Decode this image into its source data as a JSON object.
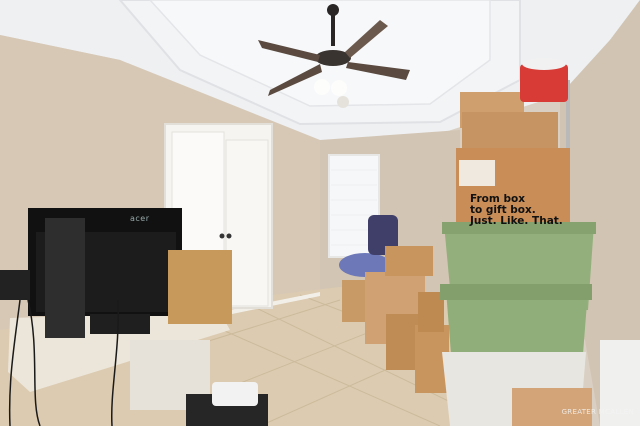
{
  "scene": {
    "box_text": [
      "From box",
      "to gift box.",
      "Just. Like. That."
    ],
    "monitor_brand": "acer",
    "watermark": "GREATER MCALLEN"
  },
  "colors": {
    "wall": "#d8ccbd",
    "ceiling": "#eef0f2",
    "floor": "#dccbb0",
    "bin_green": "#8fae7a",
    "cardboard": "#c9955e",
    "red_container": "#d83a35"
  }
}
